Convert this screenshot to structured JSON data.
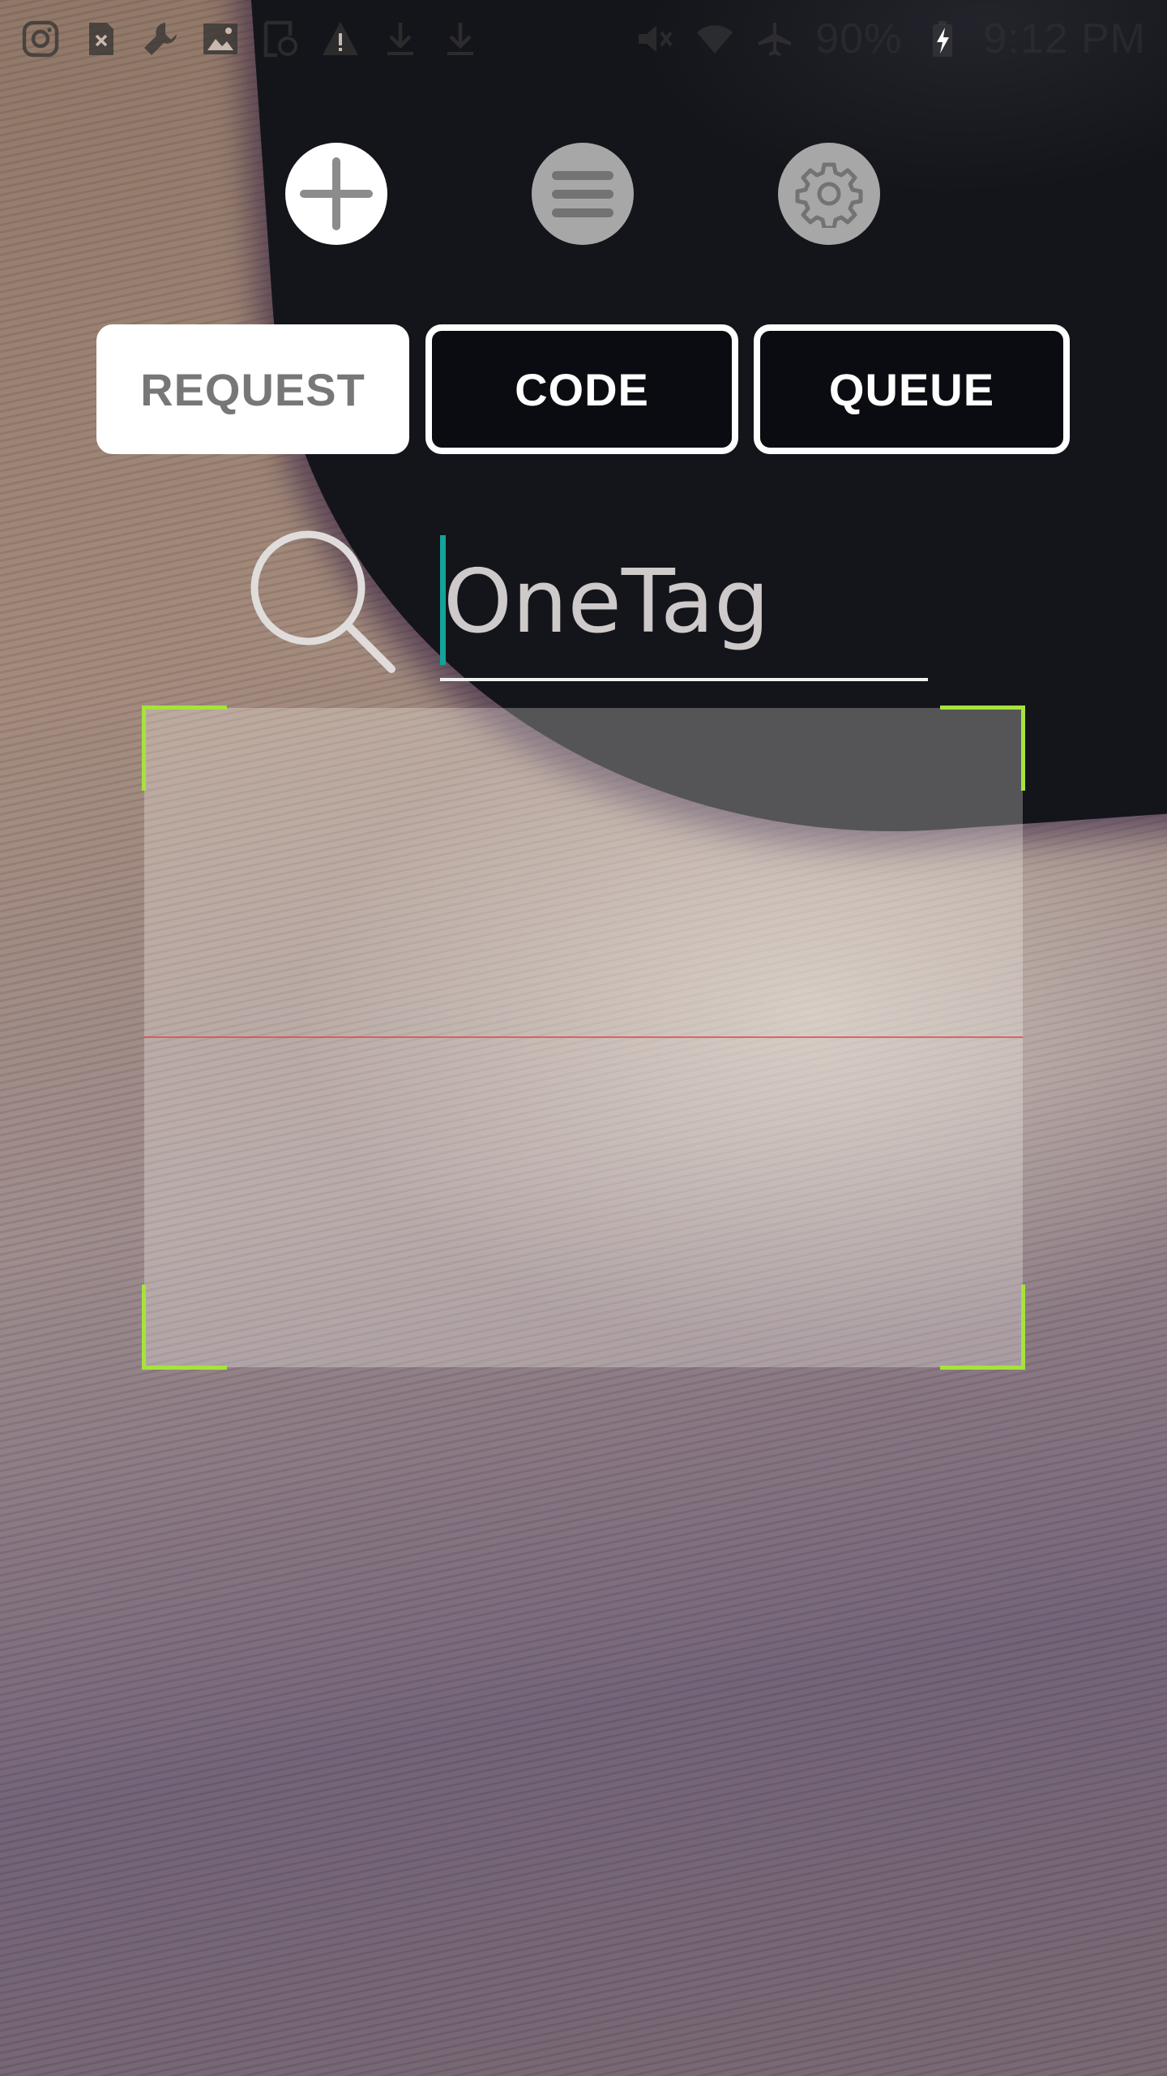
{
  "status_bar": {
    "battery": "90%",
    "time": "9:12 PM",
    "left_icons": [
      "instagram-icon",
      "sim-error-icon",
      "wrench-icon",
      "image-icon",
      "sync-icon",
      "warning-icon",
      "download-icon",
      "download-icon"
    ],
    "right_icons": [
      "mute-icon",
      "wifi-icon",
      "airplane-icon",
      "battery-charging-icon"
    ]
  },
  "toolbar": {
    "add_icon": "plus-icon",
    "menu_icon": "hamburger-icon",
    "settings_icon": "gear-icon"
  },
  "tabs": [
    {
      "label": "REQUEST",
      "selected": true
    },
    {
      "label": "CODE",
      "selected": false
    },
    {
      "label": "QUEUE",
      "selected": false
    }
  ],
  "search": {
    "placeholder": "OneTag",
    "value": ""
  },
  "colors": {
    "accent_cursor": "#14a39a",
    "scan_corner": "#a6e33b",
    "scan_line": "#e14646"
  }
}
